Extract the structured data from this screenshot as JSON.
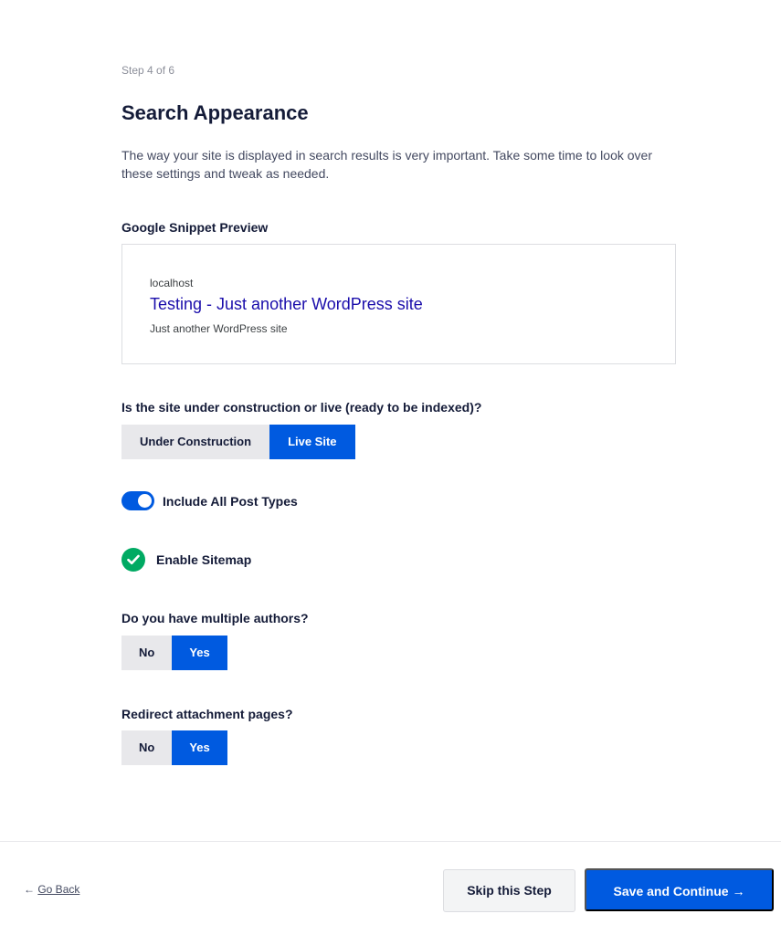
{
  "step": "Step 4 of 6",
  "title": "Search Appearance",
  "description": "The way your site is displayed in search results is very important. Take some time to look over these settings and tweak as needed.",
  "snippet": {
    "label": "Google Snippet Preview",
    "url": "localhost",
    "title": "Testing - Just another WordPress site",
    "description": "Just another WordPress site"
  },
  "site_status": {
    "question": "Is the site under construction or live (ready to be indexed)?",
    "options": [
      "Under Construction",
      "Live Site"
    ],
    "selected": "Live Site"
  },
  "post_types": {
    "label": "Include All Post Types",
    "enabled": true
  },
  "sitemap": {
    "label": "Enable Sitemap",
    "enabled": true
  },
  "multiple_authors": {
    "question": "Do you have multiple authors?",
    "options": [
      "No",
      "Yes"
    ],
    "selected": "Yes"
  },
  "redirect_attachments": {
    "question": "Redirect attachment pages?",
    "options": [
      "No",
      "Yes"
    ],
    "selected": "Yes"
  },
  "footer": {
    "back_arrow": "←",
    "back_label": "Go Back",
    "skip_label": "Skip this Step",
    "save_label": "Save and Continue →"
  },
  "colors": {
    "accent": "#005ae0",
    "success": "#00aa63",
    "snippet_title": "#1a0dab"
  }
}
